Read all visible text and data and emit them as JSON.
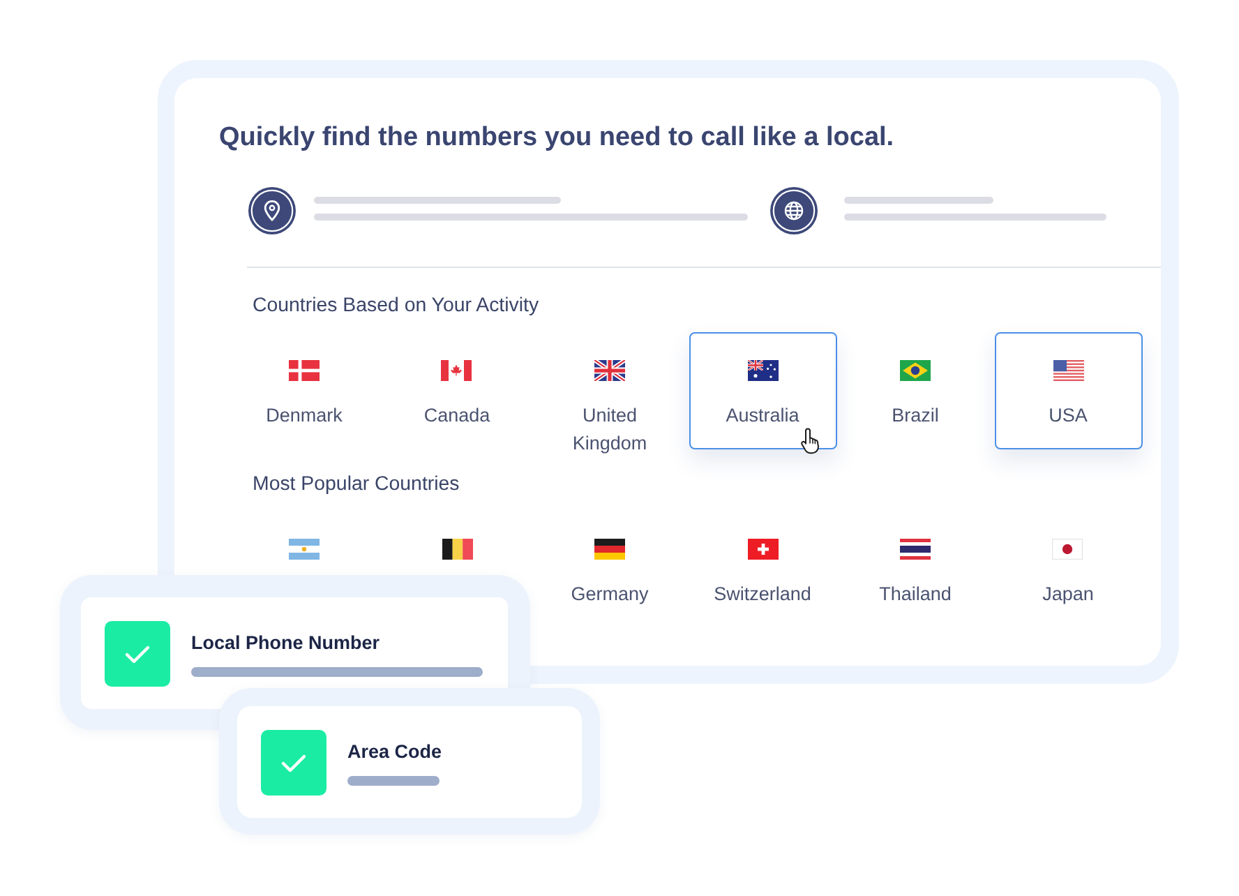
{
  "headline": "Quickly find the numbers you need to call like a local.",
  "options": [
    {
      "kind": "location"
    },
    {
      "kind": "globe"
    }
  ],
  "sections": [
    {
      "title": "Countries Based on Your Activity",
      "countries": [
        {
          "kind": "denmark",
          "label": "Denmark",
          "selected": false,
          "hovered": false
        },
        {
          "kind": "canada",
          "label": "Canada",
          "selected": false,
          "hovered": false
        },
        {
          "kind": "uk",
          "label": "United Kingdom",
          "selected": false,
          "hovered": false
        },
        {
          "kind": "australia",
          "label": "Australia",
          "selected": true,
          "hovered": true
        },
        {
          "kind": "brazil",
          "label": "Brazil",
          "selected": false,
          "hovered": false
        },
        {
          "kind": "usa",
          "label": "USA",
          "selected": true,
          "hovered": false
        }
      ]
    },
    {
      "title": "Most Popular Countries",
      "countries": [
        {
          "kind": "argentina",
          "selected": false,
          "hovered": false
        },
        {
          "kind": "belgium",
          "selected": false,
          "hovered": false
        },
        {
          "kind": "germany",
          "label": "Germany",
          "selected": false,
          "hovered": false
        },
        {
          "kind": "switzerland",
          "label": "Switzerland",
          "selected": false,
          "hovered": false
        },
        {
          "kind": "thailand",
          "label": "Thailand",
          "selected": false,
          "hovered": false
        },
        {
          "kind": "japan",
          "label": "Japan",
          "selected": false,
          "hovered": false
        }
      ]
    }
  ],
  "feature_cards": [
    {
      "label": "Local Phone Number",
      "checked": true
    },
    {
      "label": "Area Code",
      "checked": true
    }
  ]
}
